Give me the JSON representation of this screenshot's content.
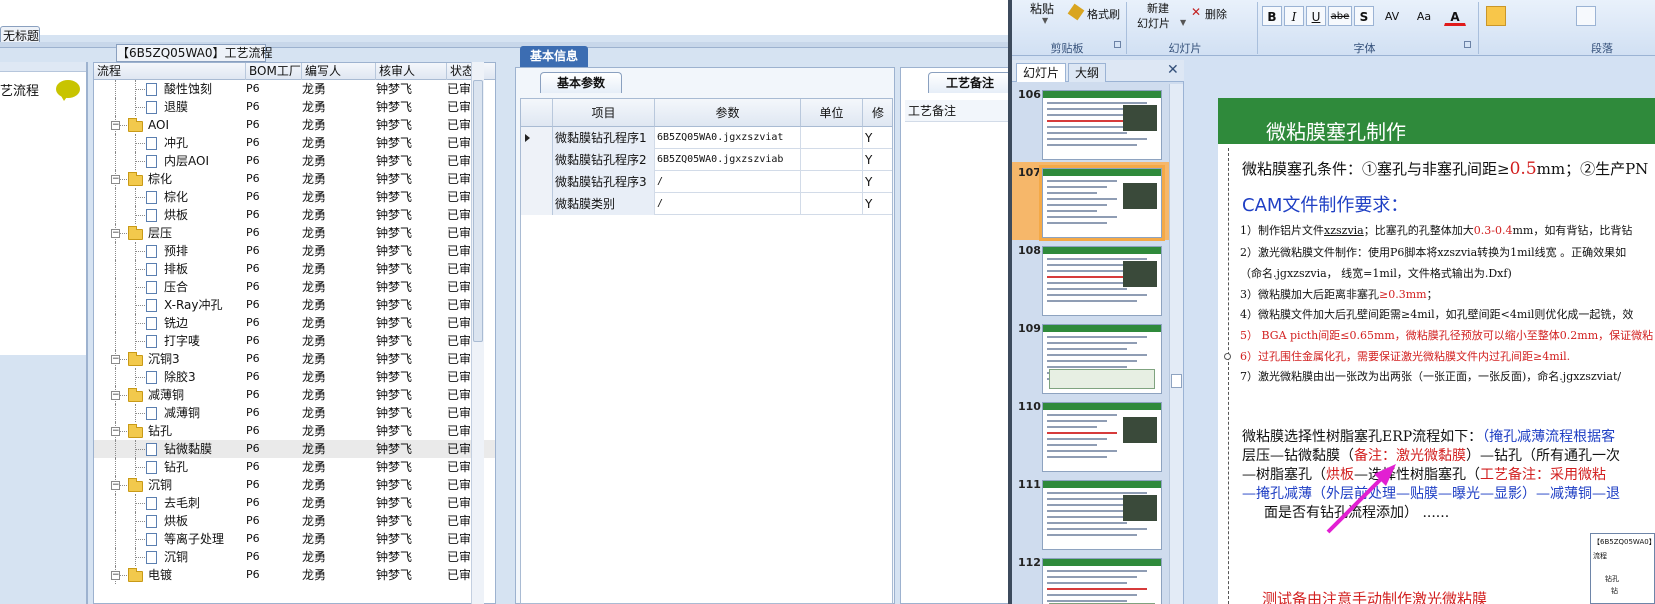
{
  "app": {
    "tab_label": "无标题",
    "flow_panel_title": "【6B5ZQ05WA0】工艺流程",
    "left_panel_label": "艺流程"
  },
  "tree": {
    "columns": [
      "流程",
      "BOM工厂",
      "编写人",
      "核审人",
      "状态"
    ],
    "rows": [
      {
        "level": 2,
        "type": "doc",
        "name": "酸性蚀刻",
        "bom": "P6",
        "author": "龙勇",
        "checker": "钟梦飞",
        "status": "已审核"
      },
      {
        "level": 2,
        "type": "doc",
        "name": "退膜",
        "bom": "P6",
        "author": "龙勇",
        "checker": "钟梦飞",
        "status": "已审核"
      },
      {
        "level": 1,
        "type": "folder",
        "name": "AOI",
        "bom": "P6",
        "author": "龙勇",
        "checker": "钟梦飞",
        "status": "已审核"
      },
      {
        "level": 2,
        "type": "doc",
        "name": "冲孔",
        "bom": "P6",
        "author": "龙勇",
        "checker": "钟梦飞",
        "status": "已审核"
      },
      {
        "level": 2,
        "type": "doc",
        "name": "内层AOI",
        "bom": "P6",
        "author": "龙勇",
        "checker": "钟梦飞",
        "status": "已审核"
      },
      {
        "level": 1,
        "type": "folder",
        "name": "棕化",
        "bom": "P6",
        "author": "龙勇",
        "checker": "钟梦飞",
        "status": "已审核"
      },
      {
        "level": 2,
        "type": "doc",
        "name": "棕化",
        "bom": "P6",
        "author": "龙勇",
        "checker": "钟梦飞",
        "status": "已审核"
      },
      {
        "level": 2,
        "type": "doc",
        "name": "烘板",
        "bom": "P6",
        "author": "龙勇",
        "checker": "钟梦飞",
        "status": "已审核"
      },
      {
        "level": 1,
        "type": "folder",
        "name": "层压",
        "bom": "P6",
        "author": "龙勇",
        "checker": "钟梦飞",
        "status": "已审核"
      },
      {
        "level": 2,
        "type": "doc",
        "name": "预排",
        "bom": "P6",
        "author": "龙勇",
        "checker": "钟梦飞",
        "status": "已审核"
      },
      {
        "level": 2,
        "type": "doc",
        "name": "排板",
        "bom": "P6",
        "author": "龙勇",
        "checker": "钟梦飞",
        "status": "已审核"
      },
      {
        "level": 2,
        "type": "doc",
        "name": "压合",
        "bom": "P6",
        "author": "龙勇",
        "checker": "钟梦飞",
        "status": "已审核"
      },
      {
        "level": 2,
        "type": "doc",
        "name": "X-Ray冲孔",
        "bom": "P6",
        "author": "龙勇",
        "checker": "钟梦飞",
        "status": "已审核"
      },
      {
        "level": 2,
        "type": "doc",
        "name": "铣边",
        "bom": "P6",
        "author": "龙勇",
        "checker": "钟梦飞",
        "status": "已审核"
      },
      {
        "level": 2,
        "type": "doc",
        "name": "打字唛",
        "bom": "P6",
        "author": "龙勇",
        "checker": "钟梦飞",
        "status": "已审核"
      },
      {
        "level": 1,
        "type": "folder",
        "name": "沉铜3",
        "bom": "P6",
        "author": "龙勇",
        "checker": "钟梦飞",
        "status": "已审核"
      },
      {
        "level": 2,
        "type": "doc",
        "name": "除胶3",
        "bom": "P6",
        "author": "龙勇",
        "checker": "钟梦飞",
        "status": "已审核"
      },
      {
        "level": 1,
        "type": "folder",
        "name": "减薄铜",
        "bom": "P6",
        "author": "龙勇",
        "checker": "钟梦飞",
        "status": "已审核"
      },
      {
        "level": 2,
        "type": "doc",
        "name": "减薄铜",
        "bom": "P6",
        "author": "龙勇",
        "checker": "钟梦飞",
        "status": "已审核"
      },
      {
        "level": 1,
        "type": "folder",
        "name": "钻孔",
        "bom": "P6",
        "author": "龙勇",
        "checker": "钟梦飞",
        "status": "已审核"
      },
      {
        "level": 2,
        "type": "doc",
        "name": "钻微黏膜",
        "bom": "P6",
        "author": "龙勇",
        "checker": "钟梦飞",
        "status": "已审核",
        "selected": true
      },
      {
        "level": 2,
        "type": "doc",
        "name": "钻孔",
        "bom": "P6",
        "author": "龙勇",
        "checker": "钟梦飞",
        "status": "已审核"
      },
      {
        "level": 1,
        "type": "folder",
        "name": "沉铜",
        "bom": "P6",
        "author": "龙勇",
        "checker": "钟梦飞",
        "status": "已审核"
      },
      {
        "level": 2,
        "type": "doc",
        "name": "去毛刺",
        "bom": "P6",
        "author": "龙勇",
        "checker": "钟梦飞",
        "status": "已审核"
      },
      {
        "level": 2,
        "type": "doc",
        "name": "烘板",
        "bom": "P6",
        "author": "龙勇",
        "checker": "钟梦飞",
        "status": "已审核"
      },
      {
        "level": 2,
        "type": "doc",
        "name": "等离子处理",
        "bom": "P6",
        "author": "龙勇",
        "checker": "钟梦飞",
        "status": "已审核"
      },
      {
        "level": 2,
        "type": "doc",
        "name": "沉铜",
        "bom": "P6",
        "author": "龙勇",
        "checker": "钟梦飞",
        "status": "已审核"
      },
      {
        "level": 1,
        "type": "folder",
        "name": "电镀",
        "bom": "P6",
        "author": "龙勇",
        "checker": "钟梦飞",
        "status": "已审核"
      }
    ]
  },
  "basic_info": {
    "tab_label": "基本信息",
    "subtab_label": "基本参数",
    "columns": [
      "项目",
      "参数",
      "单位",
      "修"
    ],
    "rows": [
      {
        "item": "微黏膜钻孔程序1",
        "param": "6B5ZQ05WA0.jgxzszviat",
        "unit": "",
        "flag": "Y"
      },
      {
        "item": "微黏膜钻孔程序2",
        "param": "6B5ZQ05WA0.jgxzszviab",
        "unit": "",
        "flag": "Y"
      },
      {
        "item": "微黏膜钻孔程序3",
        "param": "/",
        "unit": "",
        "flag": "Y"
      },
      {
        "item": "微黏膜类别",
        "param": "/",
        "unit": "",
        "flag": "Y"
      }
    ]
  },
  "process_note": {
    "tab_label": "工艺备注",
    "header_label": "工艺备注"
  },
  "ppt": {
    "ribbon": {
      "paste": "粘贴",
      "format_painter": "格式刷",
      "new_slide_line1": "新建",
      "new_slide_line2": "幻灯片",
      "delete": "删除",
      "groups": [
        "剪贴板",
        "幻灯片",
        "字体",
        "段落"
      ],
      "font_buttons": [
        "B",
        "I",
        "U",
        "abe",
        "S",
        "AV",
        "Aa",
        "A"
      ]
    },
    "pane_tabs": [
      "幻灯片",
      "大纲"
    ],
    "slide_numbers": [
      "106",
      "107",
      "108",
      "109",
      "110",
      "111",
      "112"
    ],
    "active_slide": "107",
    "slide": {
      "title": "微粘膜塞孔制作",
      "conditions_prefix": "微粘膜塞孔条件：",
      "conditions_1": "①塞孔与非塞孔间距≥",
      "conditions_1_value": "0.5",
      "conditions_1_unit": "mm；",
      "conditions_2": "②生产PN",
      "cam_heading": "CAM文件制作要求：",
      "req1_a": "1）制作铝片文件",
      "req1_b": "xzszvia",
      "req1_c": "；比塞孔的孔整体加大",
      "req1_d": "0.3-0.4",
      "req1_e": "mm，如有背钻，比背钻",
      "req2": "2）激光微粘膜文件制作：使用P6脚本将xzszvia转换为1mil线宽 。正确效果如",
      "req2b": "（命名.jgxzszvia， 线宽=1mil，文件格式输出为.Dxf)",
      "req3_a": "3）微粘膜加大后距离非塞孔",
      "req3_b": "≥0.3mm",
      "req3_c": "；",
      "req4": "4）微粘膜文件加大后孔壁间距需≥4mil，如孔壁间距<4mil则优化成一起铣，效",
      "req5": "5） BGA picth间距≤0.65mm，微粘膜孔径预放可以缩小至整体0.2mm，保证微粘",
      "req6": "6）过孔围住金属化孔，需要保证激光微粘膜文件内过孔间距≥4mil.",
      "req7": "7）激光微粘膜由出一张改为出两张（一张正面，一张反面)，命名.jgxzszviat/",
      "flow_1a": "微粘膜选择性树脂塞孔ERP流程如下：",
      "flow_1b": "（掩孔减薄流程根据客",
      "flow_2a": "层压—钻微黏膜（",
      "flow_2b": "备注：激光微黏膜",
      "flow_2c": "）—钻孔（所有通孔一次",
      "flow_3a": "—树脂塞孔（",
      "flow_3b": "烘板",
      "flow_3c": "—选择性树脂塞孔（",
      "flow_3d": "工艺备注：采用微粘",
      "flow_4a": "—掩孔减薄（外层前处理—贴膜—曝光—显影）—减薄铜—退",
      "flow_5": "面是否有钻孔流程添加） ......",
      "bottom_red": "测试备由注意手动制作激光微粘膜",
      "mini_items": [
        "【6B5ZQ05WA0】",
        "流程",
        "钻孔",
        "钻"
      ]
    }
  },
  "colors": {
    "selection_blue": "#3c6db2",
    "slide_green": "#2f8a3b",
    "ppt_bg": "#d3e1f3",
    "accent_orange": "#f4a947",
    "red_text": "#d21f1f",
    "blue_text": "#1f3fc4",
    "magenta_arrow": "#e21fd2"
  },
  "icons": [
    "speech-bubble-icon",
    "folder-icon",
    "document-icon",
    "expander-icon",
    "format-painter-icon",
    "delete-icon",
    "close-icon",
    "bold-icon",
    "italic-icon",
    "underline-icon",
    "font-color-icon",
    "align-left-icon"
  ]
}
